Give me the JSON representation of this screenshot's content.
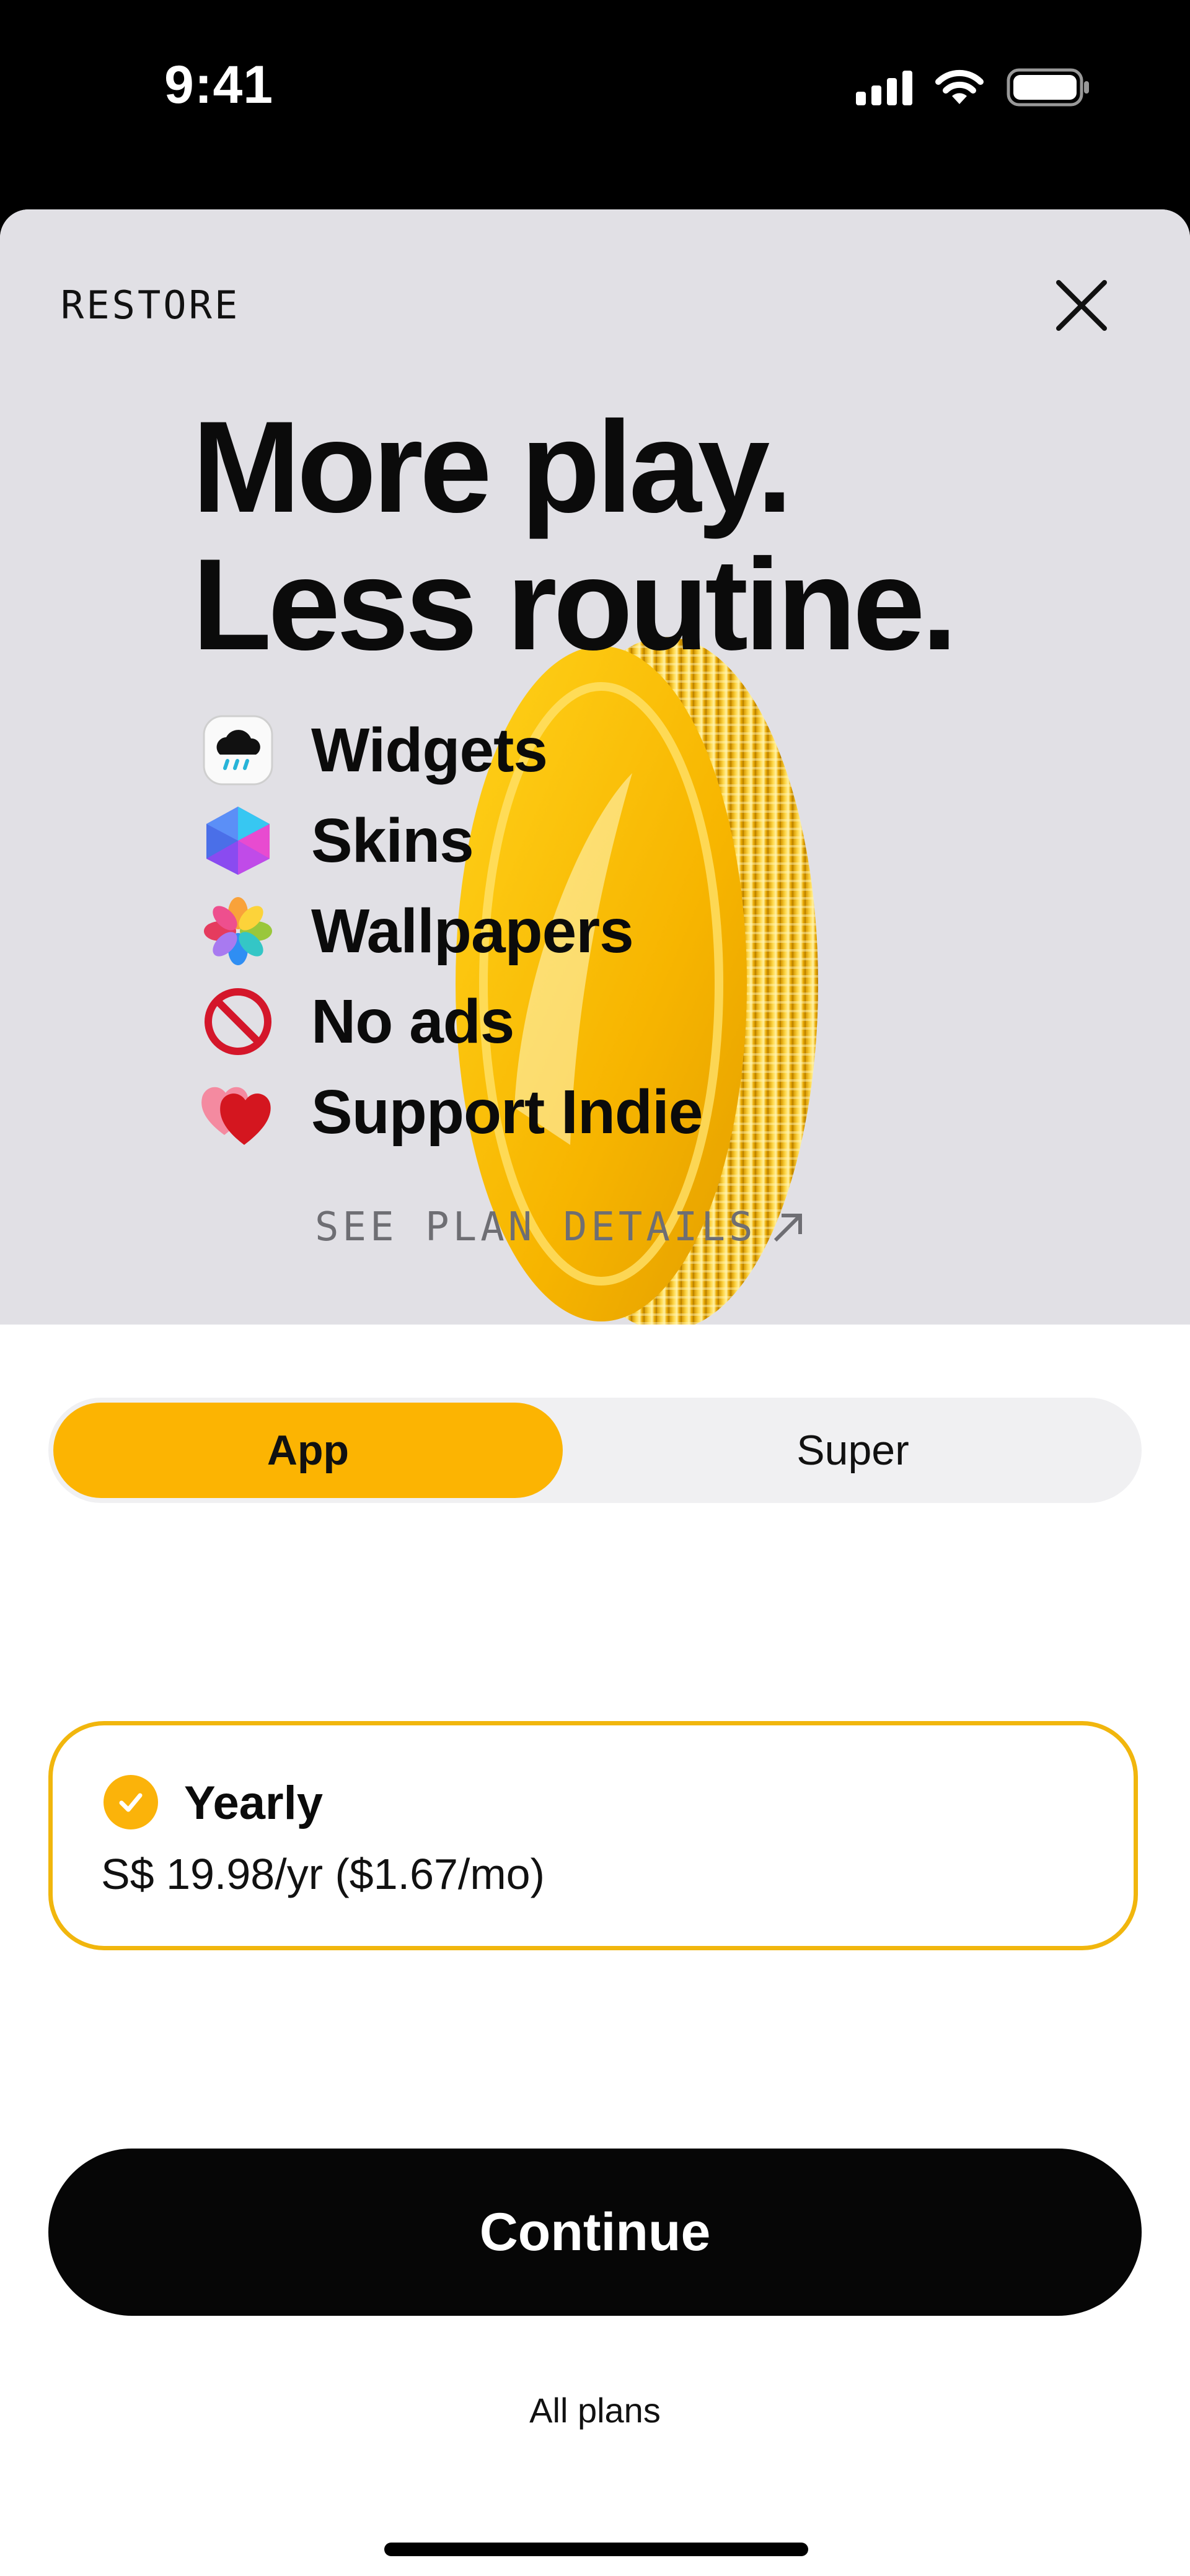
{
  "status_bar": {
    "time": "9:41"
  },
  "header": {
    "restore_label": "RESTORE"
  },
  "hero": {
    "headline_line1": "More play.",
    "headline_line2": "Less routine.",
    "features": [
      {
        "icon": "weather-widget-icon",
        "label": "Widgets"
      },
      {
        "icon": "skins-hexagon-icon",
        "label": "Skins"
      },
      {
        "icon": "wallpapers-flower-icon",
        "label": "Wallpapers"
      },
      {
        "icon": "no-ads-icon",
        "label": "No ads"
      },
      {
        "icon": "hearts-icon",
        "label": "Support Indie"
      }
    ],
    "plan_details_label": "SEE PLAN DETAILS"
  },
  "segmented_control": {
    "options": [
      "App",
      "Super"
    ],
    "selected": "App"
  },
  "plan": {
    "title": "Yearly",
    "price": "S$ 19.98/yr ($1.67/mo)",
    "selected": true
  },
  "continue_label": "Continue",
  "all_plans_label": "All plans",
  "colors": {
    "accent_yellow": "#fcb402",
    "card_border": "#f1b60d",
    "hero_bg": "#e1e0e5",
    "button_bg": "#060606"
  }
}
